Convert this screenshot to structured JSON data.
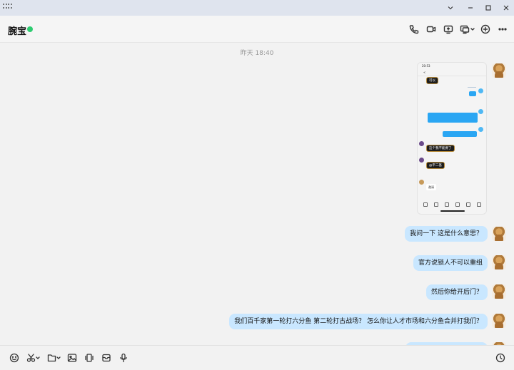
{
  "window": {
    "controls": [
      "chevron-down",
      "minimize",
      "maximize",
      "close"
    ]
  },
  "header": {
    "contact_name": "腕宝",
    "online_color": "#2ecc71",
    "actions": [
      "phone-icon",
      "video-icon",
      "screen-share-icon",
      "remote-desktop-icon",
      "add-icon",
      "more-icon"
    ]
  },
  "chat": {
    "timestamp": "昨天 18:40",
    "bubble_color": "#c9e7ff",
    "image": {
      "status_time": "20:53",
      "title": "<",
      "msgs": [
        "可以",
        "这个我不能要了",
        "@平二基",
        "邀请"
      ]
    },
    "messages": [
      {
        "text": "我问一下 这是什么意思？"
      },
      {
        "text": "官方说锁人不可以重组"
      },
      {
        "text": "然后你给开后门？"
      },
      {
        "text": "我们百千家第一轮打六分鱼 第二轮打古战场？ 怎么你让人才市场和六分鱼合并打我们？"
      }
    ]
  },
  "toolbar": {
    "icons": [
      "emoji-icon",
      "scissors-icon",
      "folder-icon",
      "image-icon",
      "shake-icon",
      "envelope-icon",
      "mic-icon",
      "history-icon"
    ]
  }
}
